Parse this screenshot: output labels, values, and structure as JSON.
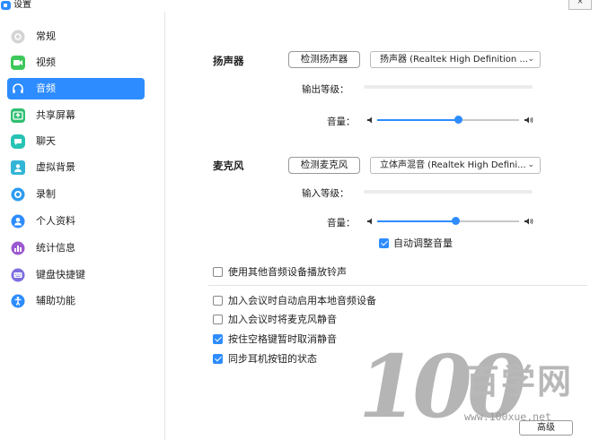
{
  "window": {
    "title": "设置",
    "close_label": "×"
  },
  "sidebar": {
    "items": [
      {
        "label": "常规",
        "icon": "gear-icon",
        "color": "#c8c8c8",
        "active": false
      },
      {
        "label": "视频",
        "icon": "video-icon",
        "color": "#3ec85c",
        "active": false
      },
      {
        "label": "音频",
        "icon": "headphones-icon",
        "color": "#2d8cff",
        "active": true
      },
      {
        "label": "共享屏幕",
        "icon": "share-screen-icon",
        "color": "#2fbf71",
        "active": false
      },
      {
        "label": "聊天",
        "icon": "chat-icon",
        "color": "#27c3b5",
        "active": false
      },
      {
        "label": "虚拟背景",
        "icon": "virtual-background-icon",
        "color": "#33b5d6",
        "active": false
      },
      {
        "label": "录制",
        "icon": "record-icon",
        "color": "#2d9cf0",
        "active": false
      },
      {
        "label": "个人资料",
        "icon": "profile-icon",
        "color": "#2d8cff",
        "active": false
      },
      {
        "label": "统计信息",
        "icon": "statistics-icon",
        "color": "#9b59d0",
        "active": false
      },
      {
        "label": "键盘快捷键",
        "icon": "keyboard-icon",
        "color": "#7c6fe0",
        "active": false
      },
      {
        "label": "辅助功能",
        "icon": "accessibility-icon",
        "color": "#2d8cff",
        "active": false
      }
    ]
  },
  "speaker": {
    "section_label": "扬声器",
    "test_button": "检测扬声器",
    "device_select": "扬声器 (Realtek High Definition ...",
    "output_level_label": "输出等级：",
    "volume_label": "音量：",
    "volume_fraction": 0.57
  },
  "microphone": {
    "section_label": "麦克风",
    "test_button": "检测麦克风",
    "device_select": "立体声混音 (Realtek High Defini...",
    "input_level_label": "输入等级：",
    "volume_label": "音量：",
    "volume_fraction": 0.55,
    "auto_adjust_label": "自动调整音量",
    "auto_adjust_checked": true
  },
  "options": [
    {
      "label": "使用其他音频设备播放铃声",
      "checked": false
    },
    {
      "label": "加入会议时自动启用本地音频设备",
      "checked": false
    },
    {
      "label": "加入会议时将麦克风静音",
      "checked": false
    },
    {
      "label": "按住空格键暂时取消静音",
      "checked": true
    },
    {
      "label": "同步耳机按钮的状态",
      "checked": true
    }
  ],
  "advanced_button": "高级",
  "watermark": {
    "number": "100",
    "chinese": "百学网",
    "url": "www.100xue.net"
  },
  "colors": {
    "accent": "#2d8cff",
    "sidebar_active_text": "#ffffff"
  }
}
